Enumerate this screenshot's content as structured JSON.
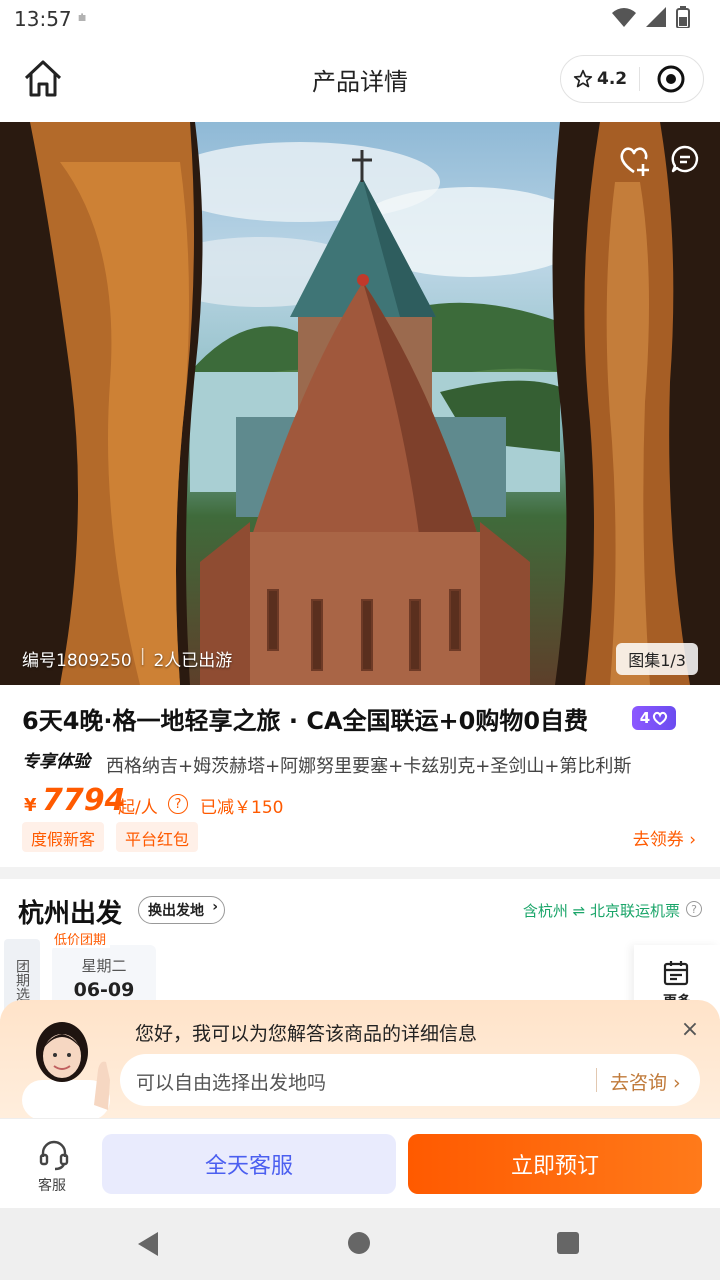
{
  "status_bar": {
    "time": "13:57",
    "indicator": "⩧"
  },
  "nav": {
    "title": "产品详情",
    "rating": "4.2"
  },
  "hero": {
    "code": "编号1809250",
    "travelers": "2人已出游",
    "gallery": "图集1/3"
  },
  "product": {
    "title": "6天4晚·格一地轻享之旅 · CA全国联运+0购物0自费",
    "badge": "4",
    "experience_tag": "专享体验",
    "route": "西格纳吉+姆茨赫塔+阿娜努里要塞+卡兹别克+圣剑山+第比利斯",
    "price_currency": "¥",
    "price": "7794",
    "price_unit": "起/人",
    "price_help": "?",
    "discount": "已减￥150",
    "coupons": [
      "度假新客",
      "平台红包"
    ],
    "coupon_link": "去领券 ›"
  },
  "departure": {
    "title": "杭州出发",
    "change_label": "换出发地",
    "flight_info": "含杭州 ⇌ 北京联运机票",
    "help": "?",
    "group_label": "团期选",
    "date_tag": "低价团期",
    "date_week": "星期二",
    "date_day": "06-09",
    "more_label": "更多"
  },
  "assistant": {
    "greeting": "您好，我可以为您解答该商品的详细信息",
    "close": "×",
    "input_text": "可以自由选择出发地吗",
    "ask_button": "去咨询 ›"
  },
  "bottom_bar": {
    "service_icon_label": "客服",
    "service_button": "全天客服",
    "book_button": "立即预订"
  },
  "colors": {
    "accent": "#ff5a00",
    "service_blue": "#4b5ff0",
    "flight_green": "#1aa569",
    "badge_purple": "#7b52f5"
  }
}
